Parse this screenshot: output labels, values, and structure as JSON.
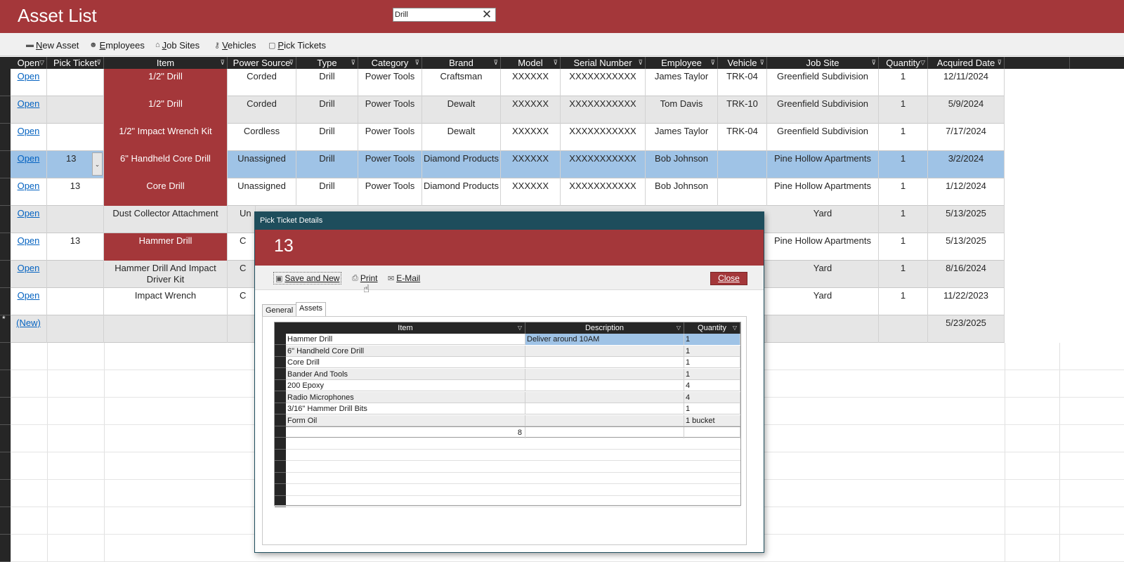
{
  "app": {
    "title": "Asset List"
  },
  "search": {
    "value": "Drill",
    "clear_icon": "close-icon"
  },
  "toolbar": {
    "new_asset": "New Asset",
    "employees": "Employees",
    "job_sites": "Job Sites",
    "vehicles": "Vehicles",
    "pick_tickets": "Pick Tickets"
  },
  "columns": [
    "Open",
    "Pick Ticket",
    "Item",
    "Power Source",
    "Type",
    "Category",
    "Brand",
    "Model",
    "Serial Number",
    "Employee",
    "Vehicle",
    "Job Site",
    "Quantity",
    "Acquired Date"
  ],
  "rows": [
    {
      "open": "Open",
      "pick": "",
      "item": "1/2\" Drill",
      "power": "Corded",
      "type": "Drill",
      "category": "Power Tools",
      "brand": "Craftsman",
      "model": "XXXXXX",
      "serial": "XXXXXXXXXXX",
      "employee": "James Taylor",
      "vehicle": "TRK-04",
      "site": "Greenfield Subdivision",
      "qty": "1",
      "date": "12/11/2024"
    },
    {
      "open": "Open",
      "pick": "",
      "item": "1/2\" Drill",
      "power": "Corded",
      "type": "Drill",
      "category": "Power Tools",
      "brand": "Dewalt",
      "model": "XXXXXX",
      "serial": "XXXXXXXXXXX",
      "employee": "Tom Davis",
      "vehicle": "TRK-10",
      "site": "Greenfield Subdivision",
      "qty": "1",
      "date": "5/9/2024"
    },
    {
      "open": "Open",
      "pick": "",
      "item": "1/2\" Impact Wrench Kit",
      "power": "Cordless",
      "type": "Drill",
      "category": "Power Tools",
      "brand": "Dewalt",
      "model": "XXXXXX",
      "serial": "XXXXXXXXXXX",
      "employee": "James Taylor",
      "vehicle": "TRK-04",
      "site": "Greenfield Subdivision",
      "qty": "1",
      "date": "7/17/2024"
    },
    {
      "open": "Open",
      "pick": "13",
      "item": "6\" Handheld Core Drill",
      "power": "Unassigned",
      "type": "Drill",
      "category": "Power Tools",
      "brand": "Diamond Products",
      "model": "XXXXXX",
      "serial": "XXXXXXXXXXX",
      "employee": "Bob Johnson",
      "vehicle": "",
      "site": "Pine Hollow Apartments",
      "qty": "1",
      "date": "3/2/2024"
    },
    {
      "open": "Open",
      "pick": "13",
      "item": "Core Drill",
      "power": "Unassigned",
      "type": "Drill",
      "category": "Power Tools",
      "brand": "Diamond Products",
      "model": "XXXXXX",
      "serial": "XXXXXXXXXXX",
      "employee": "Bob Johnson",
      "vehicle": "",
      "site": "Pine Hollow Apartments",
      "qty": "1",
      "date": "1/12/2024"
    },
    {
      "open": "Open",
      "pick": "",
      "item": "Dust Collector Attachment",
      "power": "Un",
      "type": "",
      "category": "",
      "brand": "",
      "model": "",
      "serial": "",
      "employee": "",
      "vehicle": "",
      "site": "Yard",
      "qty": "1",
      "date": "5/13/2025"
    },
    {
      "open": "Open",
      "pick": "13",
      "item": "Hammer Drill",
      "power": "C",
      "type": "",
      "category": "",
      "brand": "",
      "model": "",
      "serial": "",
      "employee": "",
      "vehicle": "",
      "site": "Pine Hollow Apartments",
      "qty": "1",
      "date": "5/13/2025"
    },
    {
      "open": "Open",
      "pick": "",
      "item": "Hammer Drill And Impact Driver Kit",
      "power": "C",
      "type": "",
      "category": "",
      "brand": "",
      "model": "",
      "serial": "",
      "employee": "",
      "vehicle": "",
      "site": "Yard",
      "qty": "1",
      "date": "8/16/2024"
    },
    {
      "open": "Open",
      "pick": "",
      "item": "Impact Wrench",
      "power": "C",
      "type": "",
      "category": "",
      "brand": "",
      "model": "",
      "serial": "",
      "employee": "",
      "vehicle": "",
      "site": "Yard",
      "qty": "1",
      "date": "11/22/2023"
    },
    {
      "open": "(New)",
      "pick": "",
      "item": "",
      "power": "",
      "type": "",
      "category": "",
      "brand": "",
      "model": "",
      "serial": "",
      "employee": "",
      "vehicle": "",
      "site": "",
      "qty": "",
      "date": "5/23/2025"
    }
  ],
  "new_row_marker": "*",
  "dialog": {
    "title": "Pick Ticket Details",
    "number": "13",
    "save_new": "Save and New",
    "print": "Print",
    "email": "E-Mail",
    "close": "Close",
    "tabs": [
      "General",
      "Assets"
    ],
    "sub_columns": [
      "Item",
      "Description",
      "Quantity"
    ],
    "items": [
      {
        "item": "Hammer Drill",
        "description": "Deliver around 10AM",
        "qty": "1"
      },
      {
        "item": "6\" Handheld Core Drill",
        "description": "",
        "qty": "1"
      },
      {
        "item": "Core Drill",
        "description": "",
        "qty": "1"
      },
      {
        "item": "Bander And Tools",
        "description": "",
        "qty": "1"
      },
      {
        "item": "200 Epoxy",
        "description": "",
        "qty": "4"
      },
      {
        "item": "Radio Microphones",
        "description": "",
        "qty": "4"
      },
      {
        "item": "3/16\" Hammer Drill Bits",
        "description": "",
        "qty": "1"
      },
      {
        "item": "Form Oil",
        "description": "",
        "qty": "1 bucket"
      }
    ],
    "total": "8"
  },
  "colors": {
    "brand": "#a4373a",
    "dialog_title": "#1e4d5c",
    "selected": "#9fc3e6",
    "link": "#0563c1"
  }
}
